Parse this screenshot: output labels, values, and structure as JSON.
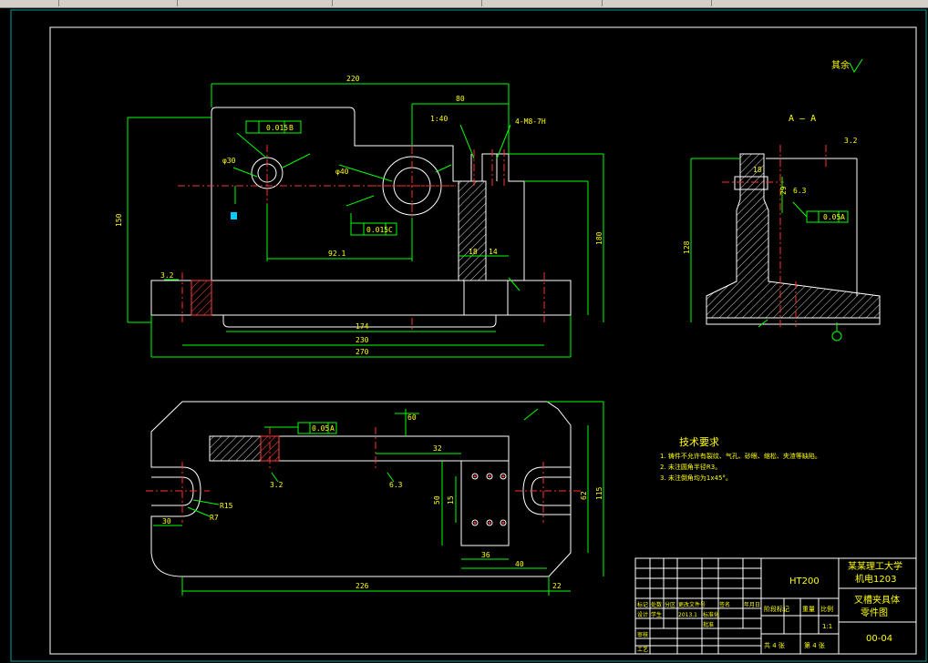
{
  "colors": {
    "background": "#000000",
    "line": "#ffffff",
    "dimension": "#00ff00",
    "center_line": "#ff0000",
    "text": "#ffff00",
    "toolbar": "#d4d0c8",
    "frame": "#00c0c0"
  },
  "drawing": {
    "roughness_note": "其余",
    "section_label": "A — A",
    "tech_title": "技术要求",
    "tech_notes": [
      "1. 铸件不允许有裂纹、气孔、砂眼、缩松、夹渣等缺陷。",
      "2. 未注圆角半径R3。",
      "3. 未注倒角均为1x45°。"
    ],
    "top_view_dims": {
      "d_220": "220",
      "d_80": "80",
      "d_174": "174",
      "d_230": "230",
      "d_270": "270",
      "d_150": "150",
      "d_180": "180",
      "d_18": "18",
      "d_14": "14",
      "tol_1": "0.015",
      "tol_2": "0.015",
      "ref_b": "B",
      "ref_c": "C",
      "ref_a": "A",
      "center_dist": "92.1",
      "thread": "4-M8-7H",
      "ratio": "1:40",
      "phi30": "φ30",
      "phi40": "φ40",
      "ra_3_2": "3.2"
    },
    "section_dims": {
      "tol": "0.05",
      "datum": "A",
      "d_128": "128",
      "d_18": "18",
      "d_29": "29",
      "ra_3_2": "3.2",
      "ra_6_3": "6.3"
    },
    "bottom_view_dims": {
      "d_50": "50",
      "d_36": "36",
      "d_30": "30",
      "d_32": "32",
      "d_62": "62",
      "d_115": "115",
      "d_226": "226",
      "d_22": "22",
      "d_40": "40",
      "d_15": "15",
      "d_60": "60",
      "r15": "R15",
      "r7": "R7",
      "tol": "0.05",
      "datum": "A",
      "ra_3_2": "3.2",
      "ra_6_3": "6.3"
    }
  },
  "title_block": {
    "school": "某某理工大学",
    "class": "机电1203",
    "material": "HT200",
    "part_name_1": "叉槽夹具体",
    "part_name_2": "零件图",
    "drawing_no": "00-04",
    "scale": "1:1",
    "sheet": "共 4 张",
    "sheet_no": "第 4 张",
    "hdr": [
      "标记",
      "处数",
      "分区",
      "更改文件号",
      "签名",
      "年月日"
    ],
    "rows": [
      "设计",
      "审核",
      "工艺"
    ],
    "row2": [
      "标准化",
      "批准"
    ],
    "stage": [
      "阶段标记",
      "重量",
      "比例"
    ],
    "designer": "学生",
    "date": "2013.1"
  }
}
